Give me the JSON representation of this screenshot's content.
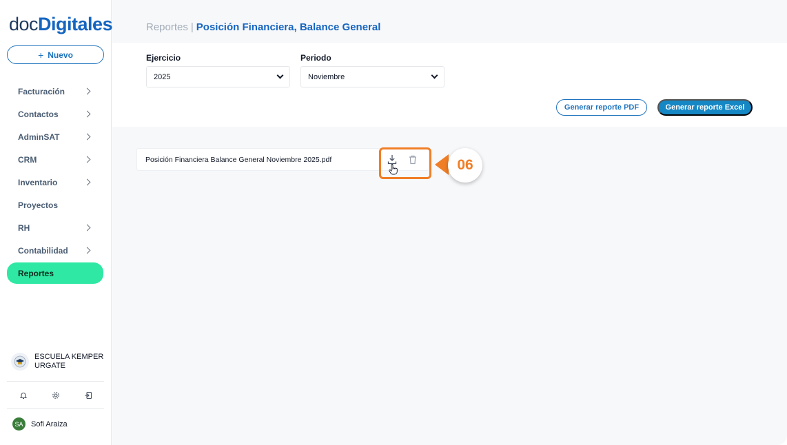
{
  "brand": {
    "part1": "doc",
    "part2": "Digitales"
  },
  "new_button": {
    "plus": "+",
    "label": "Nuevo"
  },
  "nav": [
    {
      "label": "Facturación",
      "has_chevron": true
    },
    {
      "label": "Contactos",
      "has_chevron": true
    },
    {
      "label": "AdminSAT",
      "has_chevron": true
    },
    {
      "label": "CRM",
      "has_chevron": true
    },
    {
      "label": "Inventario",
      "has_chevron": true
    },
    {
      "label": "Proyectos",
      "has_chevron": false
    },
    {
      "label": "RH",
      "has_chevron": true
    },
    {
      "label": "Contabilidad",
      "has_chevron": true
    },
    {
      "label": "Reportes",
      "has_chevron": false,
      "active": true
    }
  ],
  "organization": {
    "name": "ESCUELA KEMPER URGATE"
  },
  "utilities": [
    "bell-icon",
    "gear-icon",
    "logout-icon"
  ],
  "user": {
    "initials": "SA",
    "name": "Sofi Araiza"
  },
  "header": {
    "crumb": "Reportes",
    "separator": "|",
    "current": "Posición Financiera, Balance General"
  },
  "filters": {
    "ejercicio_label": "Ejercicio",
    "ejercicio_value": "2025",
    "periodo_label": "Periodo",
    "periodo_value": "Noviembre"
  },
  "buttons": {
    "pdf": "Generar reporte PDF",
    "excel": "Generar reporte Excel"
  },
  "files": [
    {
      "name": "Posición Financiera Balance General Noviembre 2025.pdf"
    }
  ],
  "callout": {
    "label": "06"
  },
  "colors": {
    "primary": "#1565c0",
    "button_blue": "#1587c4",
    "active_nav": "#2ee8a3",
    "highlight": "#f07e26"
  }
}
